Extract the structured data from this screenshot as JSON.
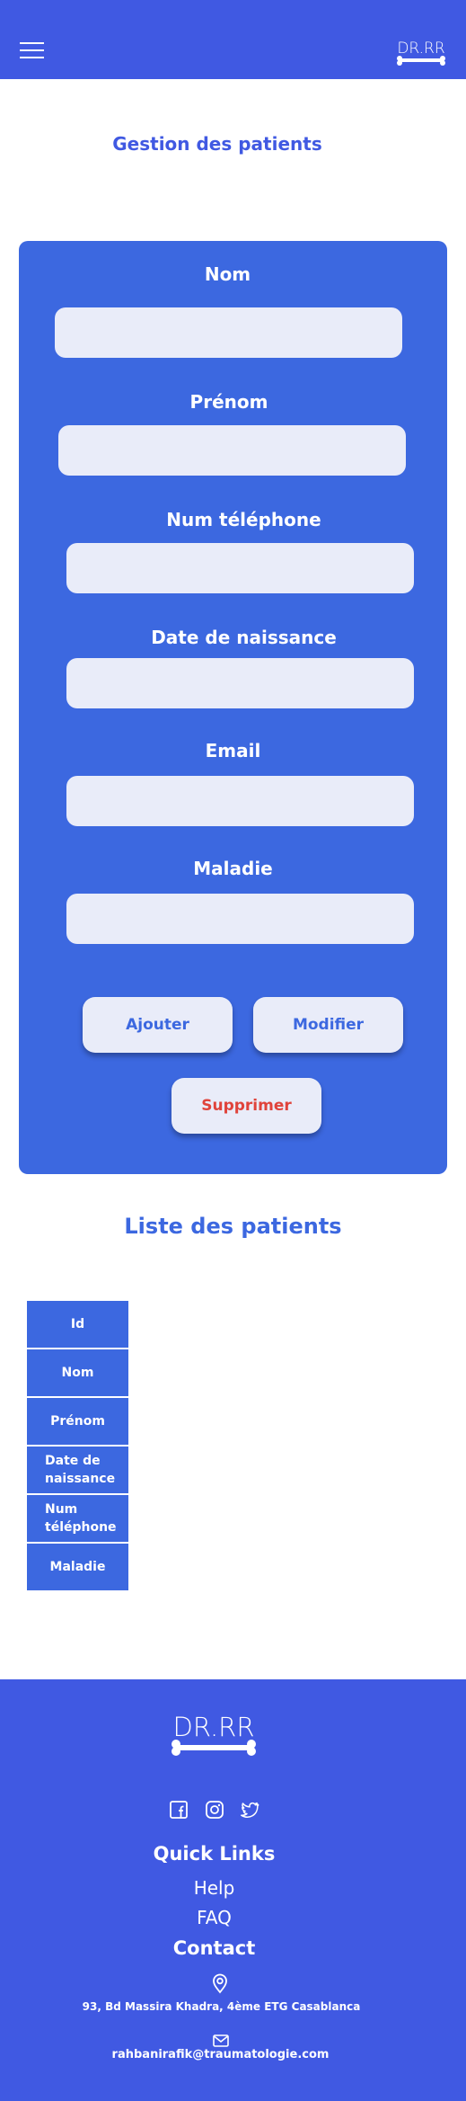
{
  "header": {
    "logo_alt": "DR.RR"
  },
  "page": {
    "title": "Gestion des patients"
  },
  "form": {
    "fields": [
      {
        "label": "Nom",
        "value": "",
        "placeholder": ""
      },
      {
        "label": "Prénom",
        "value": "",
        "placeholder": ""
      },
      {
        "label": "Num téléphone",
        "value": "",
        "placeholder": ""
      },
      {
        "label": "Date de naissance",
        "value": "",
        "placeholder": ""
      },
      {
        "label": "Email",
        "value": "",
        "placeholder": ""
      },
      {
        "label": "Maladie",
        "value": "",
        "placeholder": ""
      }
    ],
    "buttons": {
      "add": "Ajouter",
      "edit": "Modifier",
      "delete": "Supprimer"
    }
  },
  "list": {
    "title": "Liste des patients",
    "columns": [
      "Id",
      "Nom",
      "Prénom",
      "Date de naissance",
      "Num téléphone",
      "Maladie"
    ]
  },
  "footer": {
    "logo_text": "DR.RR",
    "quick_links_title": "Quick Links",
    "links": [
      "Help",
      "FAQ"
    ],
    "contact_title": "Contact",
    "address": "93, Bd Massira Khadra, 4ème ETG Casablanca",
    "email": "rahbanirafik@traumatologie.com"
  },
  "colors": {
    "primary": "#4059e2",
    "card": "#3c68e0",
    "input_bg": "#e9ecf9",
    "danger": "#e0433b"
  },
  "icons": [
    "menu-icon",
    "facebook-icon",
    "instagram-icon",
    "twitter-icon",
    "location-pin-icon",
    "mail-icon"
  ]
}
